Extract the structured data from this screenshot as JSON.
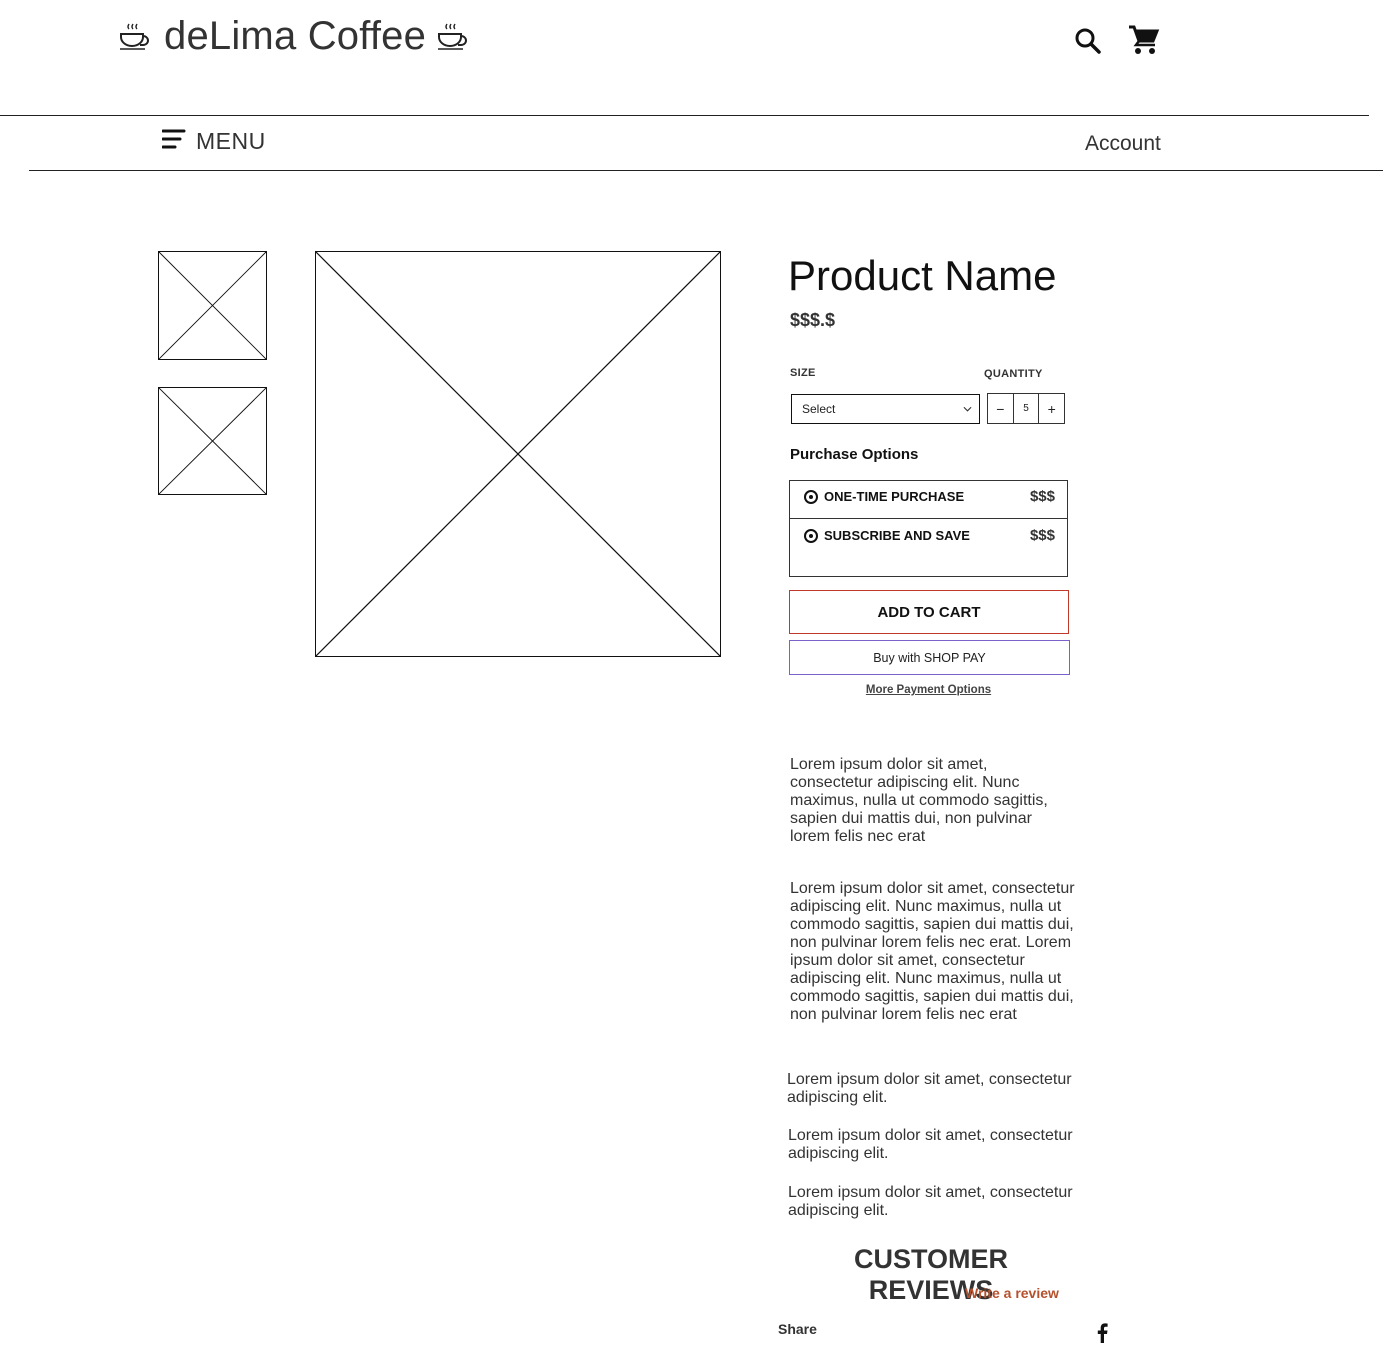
{
  "header": {
    "store_name": "deLima Coffee",
    "nav_menu_label": "MENU",
    "account_label": "Account"
  },
  "product": {
    "name": "Product Name",
    "price": "$$$.$",
    "size_label": "SIZE",
    "size_select_value": "Select",
    "quantity_label": "QUANTITY",
    "quantity_value": "5",
    "purchase_options_title": "Purchase Options",
    "purchase_options": [
      {
        "label": "ONE-TIME PURCHASE",
        "price": "$$$"
      },
      {
        "label": "SUBSCRIBE AND SAVE",
        "price": "$$$"
      }
    ],
    "add_to_cart_label": "ADD TO CART",
    "shop_pay_label": "Buy with SHOP PAY",
    "more_payment_label": "More Payment Options"
  },
  "description": {
    "paragraphs": [
      "Lorem ipsum dolor sit amet, consectetur adipiscing elit. Nunc maximus, nulla ut commodo sagittis, sapien dui mattis dui, non pulvinar lorem felis nec erat",
      "Lorem ipsum dolor sit amet, consectetur adipiscing elit. Nunc maximus, nulla ut commodo sagittis, sapien dui mattis dui, non pulvinar lorem felis nec erat. Lorem ipsum dolor sit amet, consectetur adipiscing elit. Nunc maximus, nulla ut commodo sagittis, sapien dui mattis dui, non pulvinar lorem felis nec erat",
      "Lorem ipsum dolor sit amet, consectetur adipiscing elit.",
      "Lorem ipsum dolor sit amet, consectetur adipiscing elit.",
      "Lorem ipsum dolor sit amet, consectetur adipiscing elit."
    ]
  },
  "reviews": {
    "title": "CUSTOMER REVIEWS",
    "write_review_label": "Write a review"
  },
  "share": {
    "label": "Share"
  },
  "icons": {
    "logo_left": "coffee-cup-icon",
    "logo_right": "coffee-cup-icon",
    "search": "search-icon",
    "cart": "cart-icon",
    "menu": "hamburger-icon",
    "chevron": "chevron-down-icon",
    "facebook": "facebook-icon"
  },
  "colors": {
    "add_to_cart_border": "#c0392b",
    "shop_pay_border": "#7b61c9",
    "write_review": "#b5512d"
  }
}
